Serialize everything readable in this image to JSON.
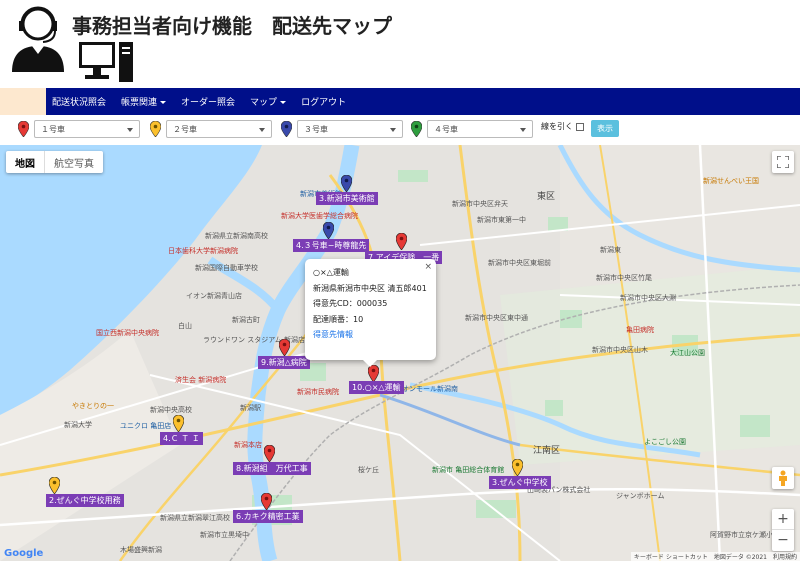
{
  "header": {
    "title": "事務担当者向け機能　配送先マップ",
    "person_icon": "headset-operator-icon",
    "pc_icon": "desktop-computer-icon"
  },
  "nav": {
    "items": [
      {
        "label": "配送状況照会",
        "dropdown": false
      },
      {
        "label": "帳票関連",
        "dropdown": true
      },
      {
        "label": "オーダー照会",
        "dropdown": false
      },
      {
        "label": "マップ",
        "dropdown": true
      },
      {
        "label": "ログアウト",
        "dropdown": false
      }
    ],
    "colors": {
      "bar": "#000f8a",
      "accent": "#fde8cf"
    }
  },
  "filters": {
    "cars": [
      {
        "label": "１号車",
        "color": "#e53935"
      },
      {
        "label": "２号車",
        "color": "#fbc02d"
      },
      {
        "label": "３号車",
        "color": "#3949ab"
      },
      {
        "label": "４号車",
        "color": "#2e9e3e"
      }
    ],
    "line_label": "線を引く",
    "line_checked": false,
    "show_button": "表示"
  },
  "map": {
    "type_map": "地図",
    "type_aerial": "航空写真",
    "attribution": "キーボード ショートカット　地図データ ©2021　利用規約",
    "google": "Google",
    "markers": [
      {
        "name": "3.新潟市美術館",
        "color": "#3949ab"
      },
      {
        "name": "4.３号車−時尊龍先",
        "color": "#3949ab"
      },
      {
        "name": "7.アイデ保険　一番",
        "color": "#e53935"
      },
      {
        "name": "9.新潟△病院",
        "color": "#e53935"
      },
      {
        "name": "10.○×△運輸",
        "color": "#e53935"
      },
      {
        "name": "4.Ｃ Ｔ Ｉ",
        "color": "#fbc02d"
      },
      {
        "name": "8.新潟組　万代工事",
        "color": "#e53935"
      },
      {
        "name": "2.ぜんぐ中学校用務",
        "color": "#fbc02d"
      },
      {
        "name": "6.カキク精密工業",
        "color": "#e53935"
      },
      {
        "name": "3.ぜんぐ中学校",
        "color": "#fbc02d"
      }
    ],
    "places": [
      "新潟市美術館",
      "日本歯科大学新潟病院",
      "新潟大学医歯学総合病院",
      "新潟県立新潟南高校",
      "新潟国際自動車学校",
      "国立西新潟中央病院",
      "イオン新潟青山店",
      "新潟古町",
      "白山",
      "ラウンドワン スタジアム 新潟店",
      "済生会 新潟病院",
      "やきとりの一",
      "新潟市民病院",
      "新潟中央高校",
      "新潟大学",
      "ユニクロ 亀田店",
      "新潟本店",
      "新潟駅",
      "新潟県立新潟翠江高校",
      "木場盛興新潟",
      "新潟市立黒埼中",
      "桜ケ丘",
      "新潟市中央区東中通",
      "新潟東",
      "江南区",
      "新潟市 亀田総合体育館",
      "山崎製パン株式会社",
      "新潟せんべい王国",
      "東区",
      "新潟市東第一中",
      "新潟市中央区弁天",
      "新潟市中央区東堀前",
      "新潟市中央区竹尾",
      "新潟市中央区大淵",
      "新潟市中央区山木",
      "亀田病院",
      "大江山公園",
      "イオンモール新潟南",
      "よこごし公園",
      "ジャンボホーム",
      "阿賀野市立京ケ瀬小"
    ],
    "popup": {
      "company": "○×△運輸",
      "address": "新潟県新潟市中央区 清五郎401",
      "customer_cd": "得意先CD：000035",
      "order": "配達順番：10",
      "link": "得意先情報"
    }
  }
}
